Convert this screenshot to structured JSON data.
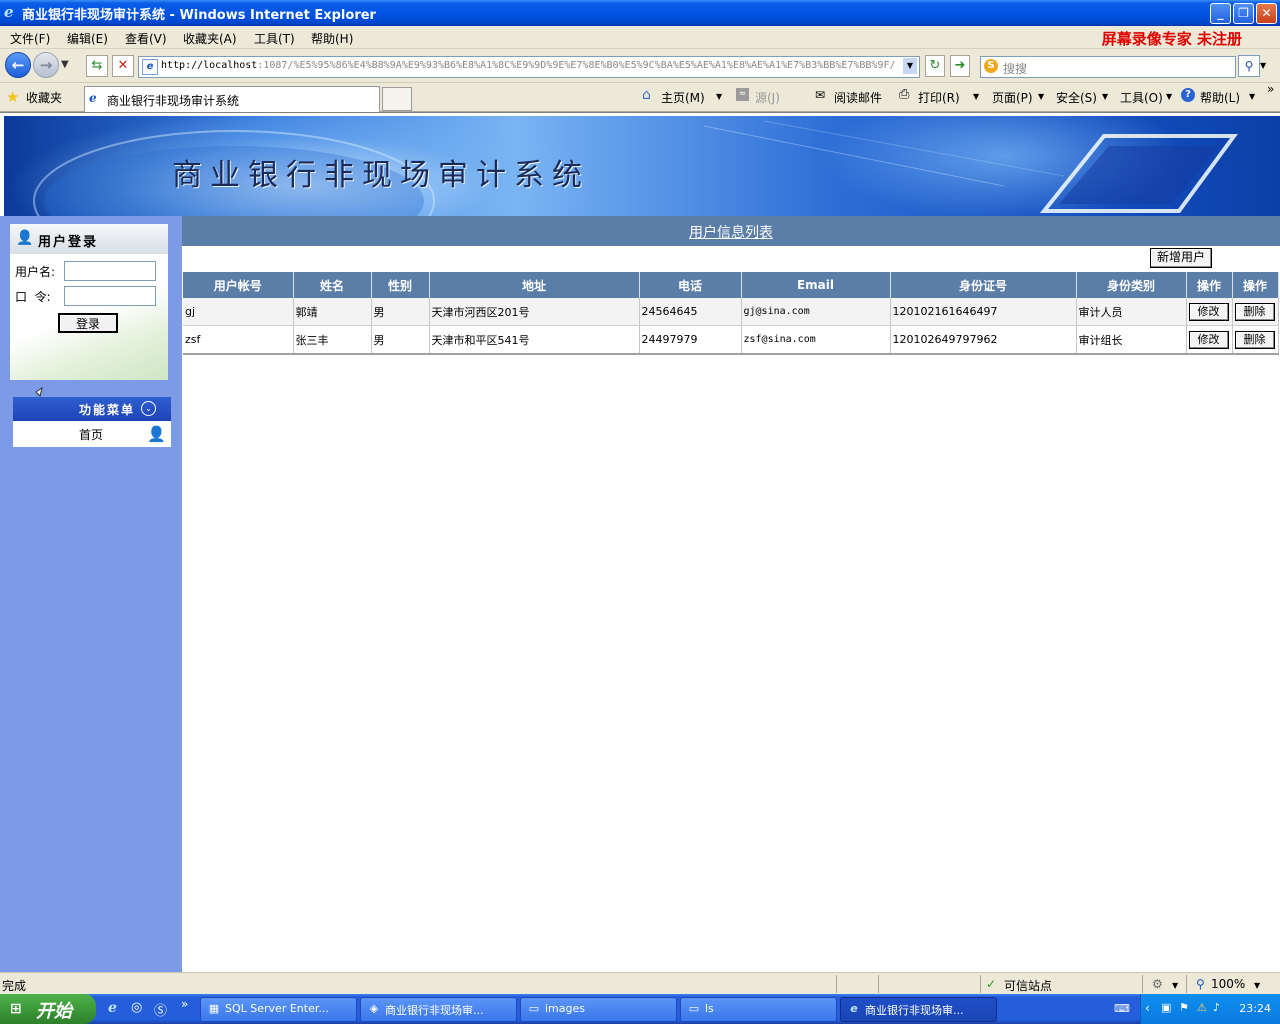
{
  "window": {
    "title": "商业银行非现场审计系统 - Windows Internet Explorer"
  },
  "menubar": {
    "items": [
      "文件(F)",
      "编辑(E)",
      "查看(V)",
      "收藏夹(A)",
      "工具(T)",
      "帮助(H)"
    ],
    "brand": "屏幕录像专家 未注册"
  },
  "address": {
    "url_host": "http://localhost",
    "url_rest": ":1087/%E5%95%86%E4%B8%9A%E9%93%B6%E8%A1%8C%E9%9D%9E%E7%8E%B0%E5%9C%BA%E5%AE%A1%E8%AE%A1%E7%B3%BB%E7%BB%9F/I",
    "search_placeholder": "搜搜"
  },
  "favbar": {
    "favorites": "收藏夹",
    "tab_title": "商业银行非现场审计系统",
    "commands": [
      "主页(M)",
      "源(J)",
      "阅读邮件",
      "打印(R)",
      "页面(P)",
      "安全(S)",
      "工具(O)",
      "帮助(L)"
    ]
  },
  "banner": {
    "title": "商业银行非现场审计系统"
  },
  "login": {
    "header": "用户登录",
    "username_label": "用户名:",
    "password_label": "口  令:",
    "username_value": "",
    "password_value": "",
    "submit": "登录"
  },
  "funcmenu": {
    "header": "功能菜单",
    "items": [
      "首页"
    ]
  },
  "main": {
    "list_title": "用户信息列表",
    "add_user": "新增用户",
    "columns": [
      "用户帐号",
      "姓名",
      "性别",
      "地址",
      "电话",
      "Email",
      "身份证号",
      "身份类别",
      "操作",
      "操作"
    ],
    "rows": [
      {
        "account": "gj",
        "name": "郭靖",
        "gender": "男",
        "address": "天津市河西区201号",
        "phone": "24564645",
        "email": "gj@sina.com",
        "id": "120102161646497",
        "type": "审计人员",
        "edit": "修改",
        "del": "删除"
      },
      {
        "account": "zsf",
        "name": "张三丰",
        "gender": "男",
        "address": "天津市和平区541号",
        "phone": "24497979",
        "email": "zsf@sina.com",
        "id": "120102649797962",
        "type": "审计组长",
        "edit": "修改",
        "del": "删除"
      }
    ]
  },
  "statusbar": {
    "left": "完成",
    "zone": "可信站点",
    "zoom": "100%"
  },
  "taskbar": {
    "start": "开始",
    "tasks": [
      "SQL Server Enter...",
      "商业银行非现场审...",
      "images",
      "ls",
      "商业银行非现场审..."
    ],
    "clock": "23:24"
  },
  "colors": {
    "titlebar": "#0054e3",
    "sidebar": "#7d9ae6",
    "table_header": "#5b7ea8",
    "brand_red": "#e00000",
    "taskbar": "#245edb"
  }
}
